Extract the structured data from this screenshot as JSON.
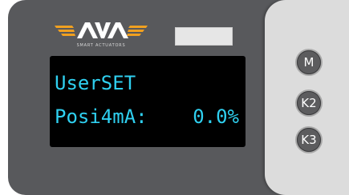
{
  "brand": {
    "name": "AVA",
    "tagline": "SMART ACTUATORS",
    "accent_color": "#f0a020"
  },
  "display": {
    "line1": "UserSET",
    "line2_label": "Posi4mA:",
    "line2_value": "0.0%",
    "text_color": "#2fd0f0"
  },
  "keys": {
    "m": "M",
    "k2": "K2",
    "k3": "K3"
  }
}
